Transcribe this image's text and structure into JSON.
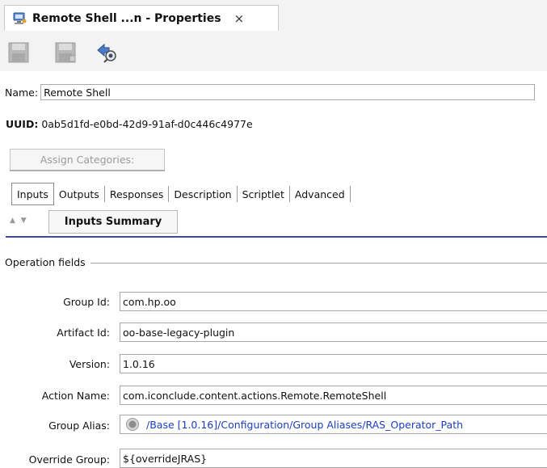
{
  "tab": {
    "title": "Remote Shell ...n - Properties",
    "close": "×"
  },
  "toolbar": {
    "save_icon": "save-icon",
    "save_all_icon": "save-all-icon",
    "nav_icon": "navigate-icon"
  },
  "name": {
    "label": "Name:",
    "value": "Remote Shell"
  },
  "uuid": {
    "label": "UUID:",
    "value": "0ab5d1fd-e0bd-42d9-91af-d0c446c4977e"
  },
  "assign_categories": "Assign Categories:",
  "tabs": [
    "Inputs",
    "Outputs",
    "Responses",
    "Description",
    "Scriptlet",
    "Advanced"
  ],
  "arrows": "▲ ▼",
  "inputs_summary": "Inputs Summary",
  "operation_fields": {
    "label": "Operation fields",
    "group_id": {
      "label": "Group Id:",
      "value": "com.hp.oo"
    },
    "artifact_id": {
      "label": "Artifact Id:",
      "value": "oo-base-legacy-plugin"
    },
    "version": {
      "label": "Version:",
      "value": "1.0.16"
    },
    "action_name": {
      "label": "Action Name:",
      "value": "com.iconclude.content.actions.Remote.RemoteShell"
    },
    "group_alias": {
      "label": "Group Alias:",
      "value": "/Base [1.0.16]/Configuration/Group Aliases/RAS_Operator_Path"
    },
    "override_group": {
      "label": "Override Group:",
      "value": "${overrideJRAS}"
    }
  },
  "colors": {
    "tab_rule": "#3d4d8f",
    "link": "#1a3fc4",
    "disabled_text": "#9a9a9a"
  }
}
